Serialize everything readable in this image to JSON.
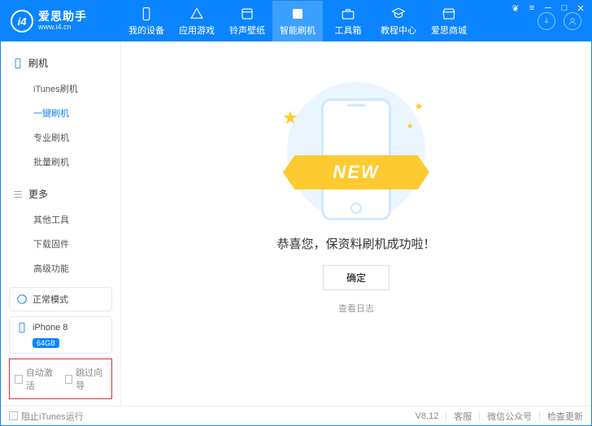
{
  "brand": {
    "logo_text": "i4",
    "cn": "爱思助手",
    "url": "www.i4.cn"
  },
  "nav": [
    {
      "label": "我的设备"
    },
    {
      "label": "应用游戏"
    },
    {
      "label": "铃声壁纸"
    },
    {
      "label": "智能刷机",
      "active": true
    },
    {
      "label": "工具箱"
    },
    {
      "label": "教程中心"
    },
    {
      "label": "爱思商城"
    }
  ],
  "sidebar": {
    "groups": [
      {
        "title": "刷机",
        "items": [
          "iTunes刷机",
          "一键刷机",
          "专业刷机",
          "批量刷机"
        ],
        "active_index": 1
      },
      {
        "title": "更多",
        "items": [
          "其他工具",
          "下载固件",
          "高级功能"
        ]
      }
    ],
    "mode": "正常模式",
    "device": {
      "name": "iPhone 8",
      "storage": "64GB"
    },
    "checkboxes": [
      "自动激活",
      "跳过向导"
    ]
  },
  "main": {
    "ribbon": "NEW",
    "success": "恭喜您，保资料刷机成功啦！",
    "ok": "确定",
    "log": "查看日志"
  },
  "footer": {
    "block_itunes": "阻止iTunes运行",
    "version": "V8.12",
    "links": [
      "客服",
      "微信公众号",
      "检查更新"
    ]
  }
}
